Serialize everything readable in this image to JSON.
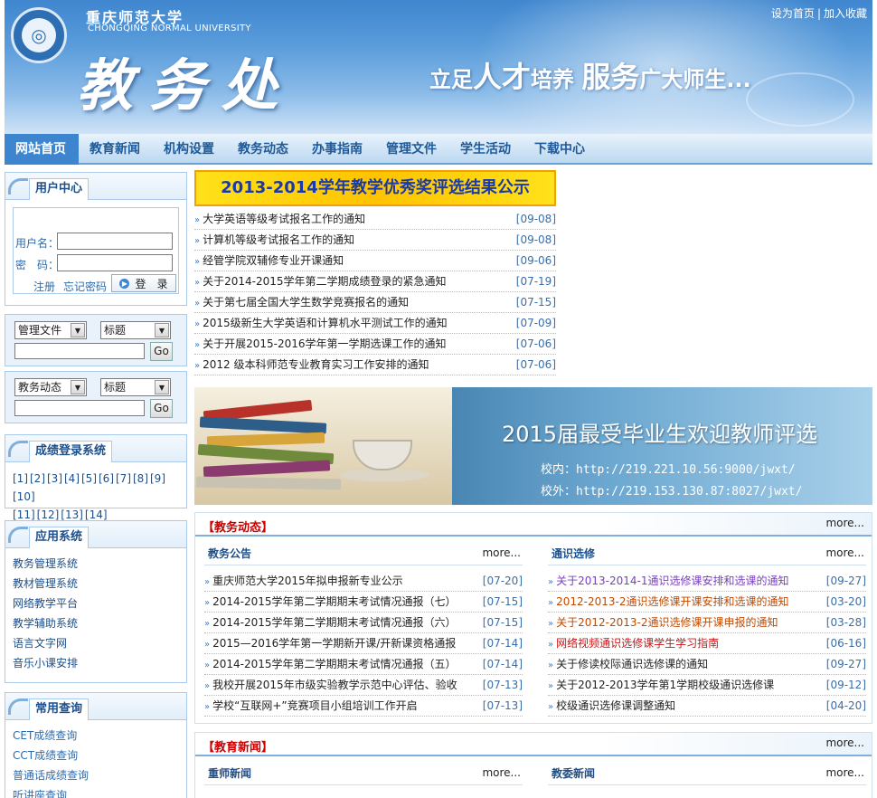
{
  "header": {
    "univ_cn": "重庆师范大学",
    "univ_en": "CHONGQING NORMAL UNIVERSITY",
    "title": "教务处",
    "slogan_parts": [
      "立足",
      "人才",
      "培养 ",
      "服务",
      "广大师生..."
    ],
    "links": [
      "设为首页",
      "加入收藏"
    ]
  },
  "nav": [
    "网站首页",
    "教育新闻",
    "机构设置",
    "教务动态",
    "办事指南",
    "管理文件",
    "学生活动",
    "下载中心"
  ],
  "user_center": {
    "title": "用户中心",
    "username_label": "用户名：",
    "password_label": "密　码：",
    "register": "注册",
    "forgot": "忘记密码",
    "login": "登　录"
  },
  "search1": {
    "category": "管理文件",
    "field": "标题",
    "go": "Go"
  },
  "search2": {
    "category": "教务动态",
    "field": "标题",
    "go": "Go"
  },
  "grades": {
    "title": "成绩登录系统",
    "links": [
      "[1]",
      "[2]",
      "[3]",
      "[4]",
      "[5]",
      "[6]",
      "[7]",
      "[8]",
      "[9]",
      "[10]",
      "[11]",
      "[12]",
      "[13]",
      "[14]"
    ]
  },
  "apps": {
    "title": "应用系统",
    "links": [
      "教务管理系统",
      "教材管理系统",
      "网络教学平台",
      "教学辅助系统",
      "语言文字网",
      "音乐小课安排"
    ]
  },
  "queries": {
    "title": "常用查询",
    "links": [
      "CET成绩查询",
      "CCT成绩查询",
      "普通话成绩查询",
      "听讲座查询"
    ]
  },
  "banner_title": "2013-2014学年教学优秀奖评选结果公示",
  "top_news": [
    {
      "t": "大学英语等级考试报名工作的通知",
      "d": "[09-08]"
    },
    {
      "t": "计算机等级考试报名工作的通知",
      "d": "[09-08]"
    },
    {
      "t": "经管学院双辅修专业开课通知",
      "d": "[09-06]"
    },
    {
      "t": "关于2014-2015学年第二学期成绩登录的紧急通知",
      "d": "[07-19]"
    },
    {
      "t": "关于第七届全国大学生数学竞赛报名的通知",
      "d": "[07-15]"
    },
    {
      "t": "2015级新生大学英语和计算机水平测试工作的通知",
      "d": "[07-09]"
    },
    {
      "t": "关于开展2015-2016学年第一学期选课工作的通知",
      "d": "[07-06]"
    },
    {
      "t": "2012 级本科师范专业教育实习工作安排的通知",
      "d": "[07-06]"
    }
  ],
  "banner2": {
    "heading": "2015届最受毕业生欢迎教师评选",
    "inner": "校内：http://219.221.10.56:9000/jwxt/",
    "outer": "校外：http://219.153.130.87:8027/jwxt/"
  },
  "jiaowu": {
    "title": "【教务动态】",
    "more": "more...",
    "left": {
      "title": "教务公告",
      "more": "more...",
      "rows": [
        {
          "t": "重庆师范大学2015年拟申报新专业公示",
          "d": "[07-20]"
        },
        {
          "t": "2014-2015学年第二学期期末考试情况通报（七）",
          "d": "[07-15]"
        },
        {
          "t": "2014-2015学年第二学期期末考试情况通报（六）",
          "d": "[07-15]"
        },
        {
          "t": "2015—2016学年第一学期新开课/开新课资格通报",
          "d": "[07-14]"
        },
        {
          "t": "2014-2015学年第二学期期末考试情况通报（五）",
          "d": "[07-14]"
        },
        {
          "t": "我校开展2015年市级实验教学示范中心评估、验收",
          "d": "[07-13]"
        },
        {
          "t": "学校“互联网+”竞赛项目小组培训工作开启",
          "d": "[07-13]"
        }
      ]
    },
    "right": {
      "title": "通识选修",
      "more": "more...",
      "rows": [
        {
          "t": "关于2013-2014-1通识选修课安排和选课的通知",
          "d": "[09-27]",
          "c": "#7a3fc0"
        },
        {
          "t": "2012-2013-2通识选修课开课安排和选课的通知",
          "d": "[03-20]",
          "c": "#c04a00"
        },
        {
          "t": "关于2012-2013-2通识选修课开课申报的通知",
          "d": "[03-28]",
          "c": "#c04a00"
        },
        {
          "t": "网络视频通识选修课学生学习指南",
          "d": "[06-16]",
          "c": "#d01010"
        },
        {
          "t": "关于修读校际通识选修课的通知",
          "d": "[09-27]",
          "c": "#222222"
        },
        {
          "t": "关于2012-2013学年第1学期校级通识选修课",
          "d": "[09-12]",
          "c": "#222222"
        },
        {
          "t": "校级通识选修课调整通知",
          "d": "[04-20]",
          "c": "#222222"
        }
      ]
    }
  },
  "jiaoyu": {
    "title": "【教育新闻】",
    "more": "more...",
    "left": {
      "title": "重师新闻",
      "more": "more..."
    },
    "right": {
      "title": "教委新闻",
      "more": "more..."
    }
  },
  "colors": {
    "nav_active": "#3d86cf",
    "accent_red": "#cc0000",
    "link_blue": "#1d4f8a"
  }
}
